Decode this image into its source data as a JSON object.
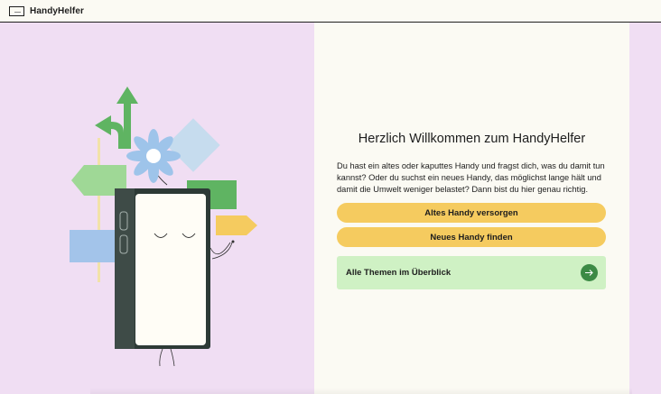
{
  "header": {
    "brand": "HandyHelfer",
    "logo_icon": "handyhelfer-logo-icon"
  },
  "main": {
    "title": "Herzlich Willkommen zum HandyHelfer",
    "intro": "Du hast ein altes oder kaputtes Handy und fragst dich, was du damit tun kannst? Oder du suchst ein neues Handy, das möglichst lange hält und damit die Umwelt weniger belastet? Dann bist du hier genau richtig.",
    "buttons": {
      "old_phone": "Altes Handy versorgen",
      "new_phone": "Neues Handy finden"
    },
    "overview_link": {
      "label": "Alle Themen im Überblick",
      "icon": "arrow-right-icon"
    },
    "illustration_icon": "phone-with-signposts-illustration"
  },
  "colors": {
    "page_lilac": "#f0def3",
    "card_bg": "#fbfaf3",
    "button_yellow": "#f5cb5f",
    "overview_green": "#cff1c4",
    "arrow_green": "#3c8a45"
  }
}
